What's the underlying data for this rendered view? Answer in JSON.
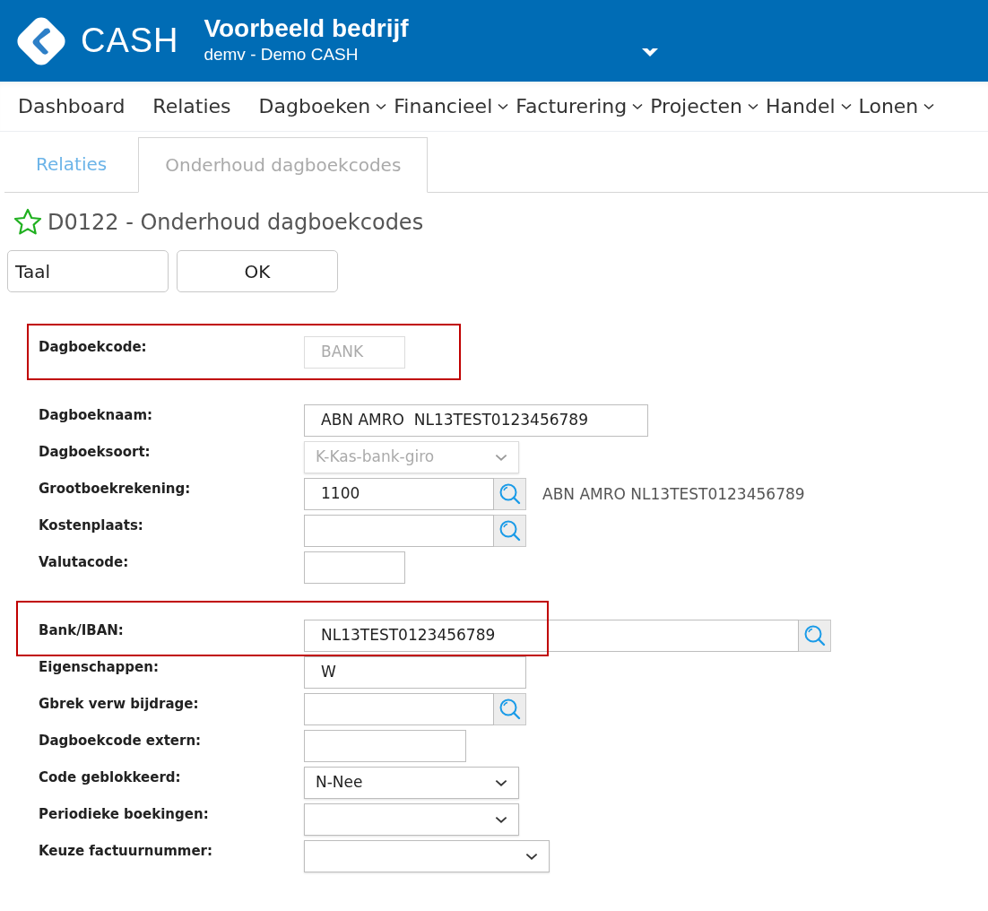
{
  "header": {
    "logo_text": "CASH",
    "company": "Voorbeeld bedrijf",
    "subtitle": "demv - Demo CASH"
  },
  "nav": [
    {
      "label": "Dashboard",
      "has_menu": false
    },
    {
      "label": "Relaties",
      "has_menu": false
    },
    {
      "label": "Dagboeken",
      "has_menu": true
    },
    {
      "label": "Financieel",
      "has_menu": true
    },
    {
      "label": "Facturering",
      "has_menu": true
    },
    {
      "label": "Projecten",
      "has_menu": true
    },
    {
      "label": "Handel",
      "has_menu": true
    },
    {
      "label": "Lonen",
      "has_menu": true
    }
  ],
  "tabs": [
    {
      "label": "Relaties",
      "selected": false
    },
    {
      "label": "Onderhoud dagboekcodes",
      "selected": true
    }
  ],
  "page_title": "D0122 - Onderhoud dagboekcodes",
  "buttons": [
    {
      "label": "Taal"
    },
    {
      "label": "OK"
    }
  ],
  "sections": [
    {
      "fields": [
        {
          "label": "Dagboekcode:",
          "kind": "text",
          "value": "BANK",
          "disabled": true,
          "highlighted": true
        }
      ]
    },
    {
      "fields": [
        {
          "label": "Dagboeknaam:",
          "kind": "text",
          "value": "ABN AMRO  NL13TEST0123456789",
          "disabled": false,
          "highlighted": false
        },
        {
          "label": "Dagboeksoort:",
          "kind": "select",
          "value": "K-Kas-bank-giro",
          "disabled": true,
          "highlighted": false
        },
        {
          "label": "Grootboekrekening:",
          "kind": "lookup",
          "value": "1100",
          "description": "ABN AMRO NL13TEST0123456789",
          "disabled": false,
          "highlighted": false
        },
        {
          "label": "Kostenplaats:",
          "kind": "lookup",
          "disabled": false,
          "highlighted": false
        },
        {
          "label": "Valutacode:",
          "kind": "text",
          "disabled": false,
          "highlighted": false
        }
      ]
    },
    {
      "fields": [
        {
          "label": "Bank/IBAN:",
          "kind": "lookup",
          "value": "NL13TEST0123456789",
          "disabled": false,
          "highlighted": true
        },
        {
          "label": "Eigenschappen:",
          "kind": "text",
          "value": "W",
          "disabled": false,
          "highlighted": false
        },
        {
          "label": "Gbrek verw bijdrage:",
          "kind": "lookup",
          "disabled": false,
          "highlighted": false
        },
        {
          "label": "Dagboekcode extern:",
          "kind": "text",
          "disabled": false,
          "highlighted": false
        },
        {
          "label": "Code geblokkeerd:",
          "kind": "select",
          "value": "N-Nee",
          "disabled": false,
          "highlighted": false
        },
        {
          "label": "Periodieke boekingen:",
          "kind": "select",
          "disabled": false,
          "highlighted": false
        },
        {
          "label": "Keuze factuurnummer:",
          "kind": "select",
          "disabled": false,
          "highlighted": false
        }
      ]
    }
  ]
}
